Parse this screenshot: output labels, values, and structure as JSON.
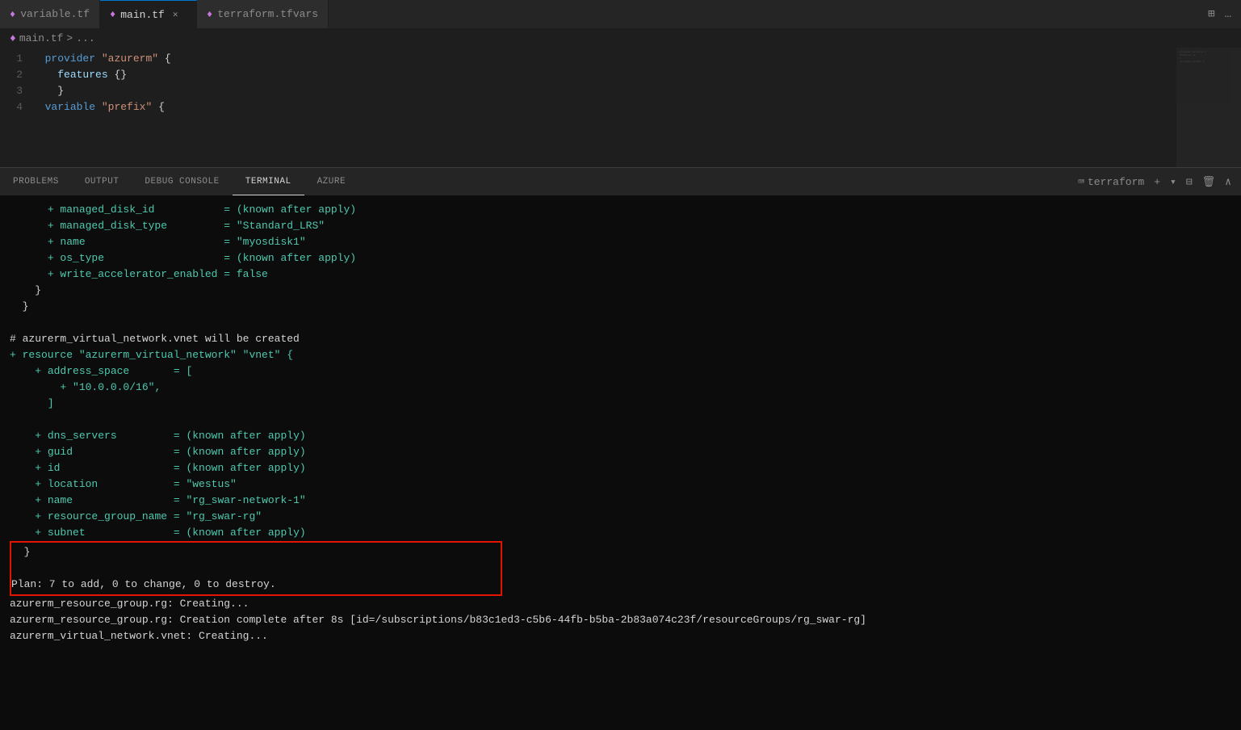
{
  "tabs": [
    {
      "id": "variable-tf",
      "label": "variable.tf",
      "active": false,
      "icon": "♦",
      "closeable": false
    },
    {
      "id": "main-tf",
      "label": "main.tf",
      "active": true,
      "icon": "♦",
      "closeable": true
    },
    {
      "id": "terraform-tfvars",
      "label": "terraform.tfvars",
      "active": false,
      "icon": "♦",
      "closeable": false
    }
  ],
  "breadcrumb": {
    "icon": "♦",
    "file": "main.tf",
    "separator": ">",
    "context": "..."
  },
  "editor": {
    "lines": [
      {
        "num": "1",
        "content": "  provider \"azurerm\" {"
      },
      {
        "num": "2",
        "content": "    features {}"
      },
      {
        "num": "3",
        "content": "    }"
      },
      {
        "num": "4",
        "content": "  variable \"prefix\" {"
      }
    ]
  },
  "panel": {
    "tabs": [
      {
        "id": "problems",
        "label": "PROBLEMS",
        "active": false
      },
      {
        "id": "output",
        "label": "OUTPUT",
        "active": false
      },
      {
        "id": "debug-console",
        "label": "DEBUG CONSOLE",
        "active": false
      },
      {
        "id": "terminal",
        "label": "TERMINAL",
        "active": true
      },
      {
        "id": "azure",
        "label": "AZURE",
        "active": false
      }
    ],
    "terminal_name": "terraform",
    "terminal_content": [
      {
        "type": "normal",
        "text": "      + managed_disk_id           = (known after apply)"
      },
      {
        "type": "normal",
        "text": "      + managed_disk_type         = \"Standard_LRS\""
      },
      {
        "type": "normal",
        "text": "      + name                      = \"myosdisk1\""
      },
      {
        "type": "normal",
        "text": "      + os_type                   = (known after apply)"
      },
      {
        "type": "normal",
        "text": "      + write_accelerator_enabled = false"
      },
      {
        "type": "normal",
        "text": "    }"
      },
      {
        "type": "normal",
        "text": "  }"
      },
      {
        "type": "empty",
        "text": ""
      },
      {
        "type": "normal",
        "text": "# azurerm_virtual_network.vnet will be created"
      },
      {
        "type": "normal",
        "text": "+ resource \"azurerm_virtual_network\" \"vnet\" {"
      },
      {
        "type": "normal",
        "text": "    + address_space       = ["
      },
      {
        "type": "normal",
        "text": "        + \"10.0.0.0/16\","
      },
      {
        "type": "normal",
        "text": "      ]"
      },
      {
        "type": "empty",
        "text": ""
      },
      {
        "type": "normal",
        "text": "    + dns_servers         = (known after apply)"
      },
      {
        "type": "normal",
        "text": "    + guid                = (known after apply)"
      },
      {
        "type": "normal",
        "text": "    + id                  = (known after apply)"
      },
      {
        "type": "normal",
        "text": "    + location            = \"westus\""
      },
      {
        "type": "normal",
        "text": "    + name                = \"rg_swar-network-1\""
      },
      {
        "type": "normal",
        "text": "    + resource_group_name = \"rg_swar-rg\""
      },
      {
        "type": "normal",
        "text": "    + subnet              = (known after apply)"
      },
      {
        "type": "highlight-start",
        "text": "  }"
      },
      {
        "type": "highlight-end",
        "text": ""
      },
      {
        "type": "highlight-plan",
        "text": "Plan: 7 to add, 0 to change, 0 to destroy."
      },
      {
        "type": "normal",
        "text": "azurerm_resource_group.rg: Creating..."
      },
      {
        "type": "normal",
        "text": "azurerm_resource_group.rg: Creation complete after 8s [id=/subscriptions/b83c1ed3-c5b6-44fb-b5ba-2b83a074c23f/resourceGroups/rg_swar-rg]"
      },
      {
        "type": "normal",
        "text": "azurerm_virtual_network.vnet: Creating..."
      }
    ]
  }
}
